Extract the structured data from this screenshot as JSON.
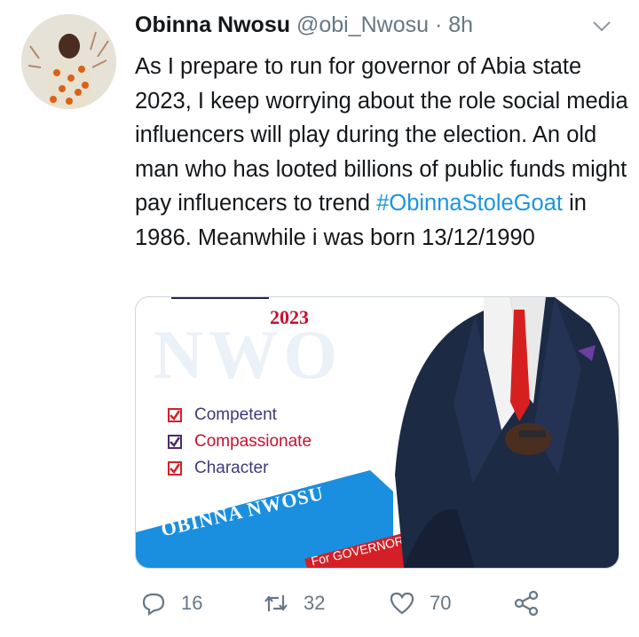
{
  "tweet": {
    "author_name": "Obinna Nwosu",
    "handle": "@obi_Nwosu",
    "separator": "·",
    "time": "8h",
    "text_before": "As I prepare to run for governor of Abia state 2023, I keep worrying about the role social media influencers will play during the election. An old man who has looted billions of public funds might pay influencers to trend ",
    "hashtag": "#ObinnaStoleGoat",
    "text_after": " in 1986. Meanwhile i was born 13/12/1990"
  },
  "media": {
    "year": "2023",
    "bg_letters": "NWO",
    "checklist": [
      {
        "label": "Competent",
        "color": "#3d3a7a",
        "box_color": "#d32027"
      },
      {
        "label": "Compassionate",
        "color": "#c8102e",
        "box_color": "#4b2a6e"
      },
      {
        "label": "Character",
        "color": "#3d3a7a",
        "box_color": "#d32027"
      }
    ],
    "banner_name": "OBINNA NWOSU",
    "banner_sub": "For GOVERNOR",
    "banner_color": "#1a8fe0",
    "banner_sub_color": "#d32027"
  },
  "actions": {
    "reply_count": "16",
    "retweet_count": "32",
    "like_count": "70"
  },
  "colors": {
    "text": "#14171a",
    "secondary": "#657786",
    "link": "#1b95e0"
  }
}
